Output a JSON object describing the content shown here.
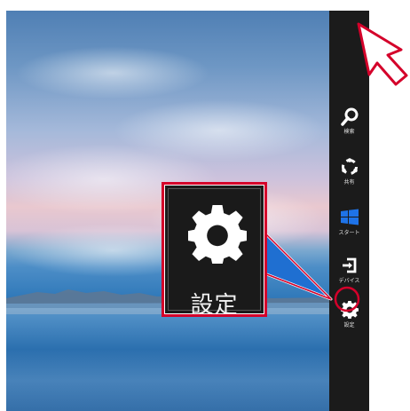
{
  "charms": [
    {
      "label": "検索",
      "icon": "search-icon"
    },
    {
      "label": "共有",
      "icon": "share-icon"
    },
    {
      "label": "スタート",
      "icon": "windows-logo-icon"
    },
    {
      "label": "デバイス",
      "icon": "devices-icon"
    },
    {
      "label": "設定",
      "icon": "gear-icon"
    }
  ],
  "callout": {
    "label": "設定",
    "icon": "gear-icon"
  },
  "colors": {
    "charm_bar": "#1b1b1b",
    "highlight": "#d4002a",
    "callout_arrow": "#1f6fd1",
    "start_tile": "#1e73e8"
  }
}
